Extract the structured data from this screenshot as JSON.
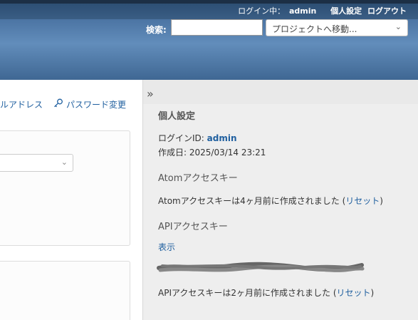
{
  "top_menu": {
    "logged_in_label": "ログイン中：",
    "user": "admin",
    "my_account": "個人設定",
    "logout": "ログアウト"
  },
  "header": {
    "search_label": "検索:",
    "search_value": "",
    "project_jump": "プロジェクトへ移動..."
  },
  "contextual": {
    "email_link": "ルアドレス",
    "password_link": "パスワード変更"
  },
  "sidebar": {
    "toggle": "»",
    "title": "個人設定",
    "login_label": "ログインID: ",
    "login_value": "admin",
    "created_label": "作成日: ",
    "created_value": "2025/03/14 23:21",
    "atom_heading": "Atomアクセスキー",
    "atom_text": "Atomアクセスキーは4ヶ月前に作成されました (",
    "atom_reset": "リセット",
    "close_paren": ")",
    "api_heading": "APIアクセスキー",
    "api_show": "表示",
    "api_text": "APIアクセスキーは2ヶ月前に作成されました (",
    "api_reset": "リセット"
  },
  "colors": {
    "link": "#1f5f9f",
    "header": "#4b74a3",
    "top_bar": "#2d4f74",
    "sidebar_bg": "#eeeeee"
  }
}
